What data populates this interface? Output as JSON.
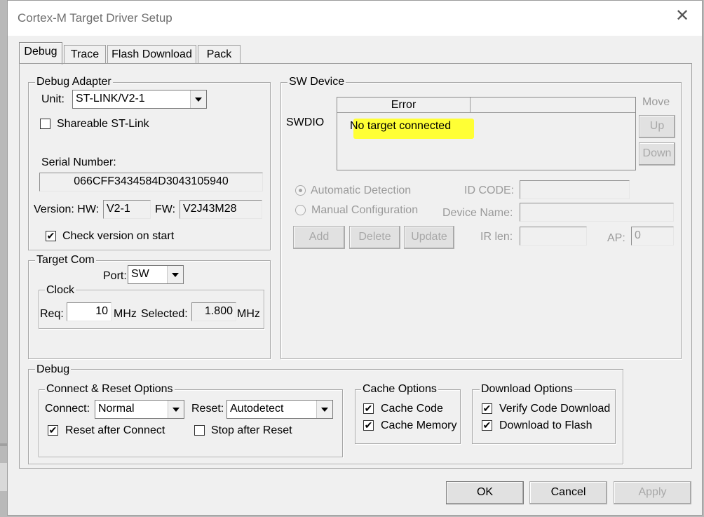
{
  "window": {
    "title": "Cortex-M Target Driver Setup",
    "close_label": "✕"
  },
  "tabs": [
    "Debug",
    "Trace",
    "Flash Download",
    "Pack"
  ],
  "debug_adapter": {
    "group_label": "Debug Adapter",
    "unit_label": "Unit:",
    "unit_value": "ST-LINK/V2-1",
    "shareable_label": "Shareable ST-Link",
    "shareable_checked": false,
    "serial_label": "Serial Number:",
    "serial_value": "066CFF3434584D3043105940",
    "version_label": "Version: HW:",
    "hw_value": "V2-1",
    "fw_label": "FW:",
    "fw_value": "V2J43M28",
    "check_version_label": "Check version on start",
    "check_version_checked": true
  },
  "target_com": {
    "group_label": "Target Com",
    "port_label": "Port:",
    "port_value": "SW",
    "clock_label": "Clock",
    "req_label": "Req:",
    "req_value": "10",
    "req_unit": "MHz",
    "selected_label": "Selected:",
    "selected_value": "1.800",
    "selected_unit": "MHz"
  },
  "sw_device": {
    "group_label": "SW Device",
    "move_label": "Move",
    "up_label": "Up",
    "down_label": "Down",
    "swdio_label": "SWDIO",
    "column_error": "Error",
    "error_message": "No target connected",
    "auto_detect_label": "Automatic Detection",
    "manual_config_label": "Manual Configuration",
    "id_code_label": "ID CODE:",
    "device_name_label": "Device Name:",
    "ir_len_label": "IR len:",
    "ap_label": "AP:",
    "ap_value": "0",
    "add_label": "Add",
    "delete_label": "Delete",
    "update_label": "Update"
  },
  "debug": {
    "group_label": "Debug",
    "connect_reset_label": "Connect & Reset Options",
    "connect_label": "Connect:",
    "connect_value": "Normal",
    "reset_label": "Reset:",
    "reset_value": "Autodetect",
    "reset_after_connect_label": "Reset after Connect",
    "stop_after_reset_label": "Stop after Reset",
    "cache_options_label": "Cache Options",
    "cache_code_label": "Cache Code",
    "cache_memory_label": "Cache Memory",
    "download_options_label": "Download Options",
    "verify_code_label": "Verify Code Download",
    "download_flash_label": "Download to Flash"
  },
  "footer": {
    "ok_label": "OK",
    "cancel_label": "Cancel",
    "apply_label": "Apply"
  },
  "check_glyph": "✔",
  "colors": {
    "highlight": "#ffff35",
    "disabled_text": "#9a9a9a",
    "dialog_bg": "#f0f0f0"
  }
}
